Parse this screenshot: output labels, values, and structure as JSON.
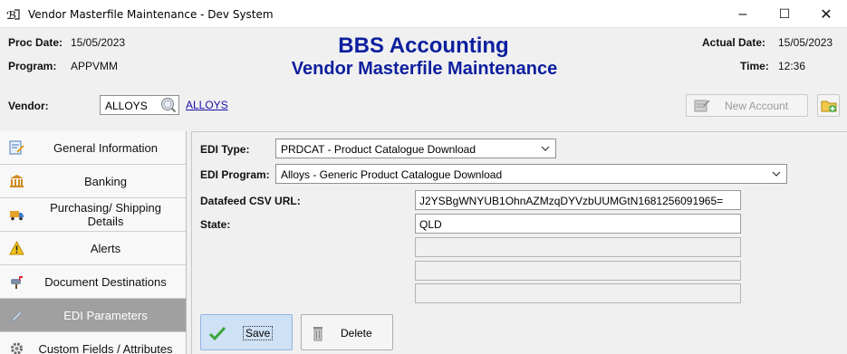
{
  "window": {
    "title": "Vendor Masterfile Maintenance - Dev System",
    "minimize_glyph": "–",
    "maximize_glyph": "☐",
    "close_glyph": "✕"
  },
  "header": {
    "proc_date_label": "Proc Date:",
    "proc_date_value": "15/05/2023",
    "program_label": "Program:",
    "program_value": "APPVMM",
    "app_name": "BBS Accounting",
    "screen_name": "Vendor Masterfile Maintenance",
    "actual_date_label": "Actual Date:",
    "actual_date_value": "15/05/2023",
    "time_label": "Time:",
    "time_value": "12:36"
  },
  "vendor": {
    "label": "Vendor:",
    "code": "ALLOYS",
    "link_text": "ALLOYS",
    "new_account_label": "New Account"
  },
  "sidebar": {
    "items": [
      {
        "label": "General Information",
        "icon": "edit-form-icon"
      },
      {
        "label": "Banking",
        "icon": "bank-icon"
      },
      {
        "label": "Purchasing/ Shipping Details",
        "icon": "truck-icon"
      },
      {
        "label": "Alerts",
        "icon": "warning-icon"
      },
      {
        "label": "Document Destinations",
        "icon": "mailbox-icon"
      },
      {
        "label": "EDI Parameters",
        "icon": "pencil-icon",
        "active": true
      },
      {
        "label": "Custom Fields / Attributes",
        "icon": "gear-icon"
      }
    ]
  },
  "edi": {
    "type_label": "EDI Type:",
    "type_value": "PRDCAT - Product Catalogue Download",
    "program_label": "EDI Program:",
    "program_value": "Alloys - Generic Product Catalogue Download",
    "params": [
      {
        "label": "Datafeed CSV URL:",
        "value": "J2YSBgWNYUB1OhnAZMzqDYVzbUUMGtN1681256091965="
      },
      {
        "label": "State:",
        "value": "QLD"
      },
      {
        "label": "",
        "value": ""
      },
      {
        "label": "",
        "value": ""
      },
      {
        "label": "",
        "value": ""
      }
    ]
  },
  "actions": {
    "save_label": "Save",
    "delete_label": "Delete"
  },
  "colors": {
    "title_blue": "#0c1f9e",
    "link_blue": "#1a0dab",
    "active_nav": "#a0a0a0",
    "save_highlight": "#cfe1f5"
  }
}
